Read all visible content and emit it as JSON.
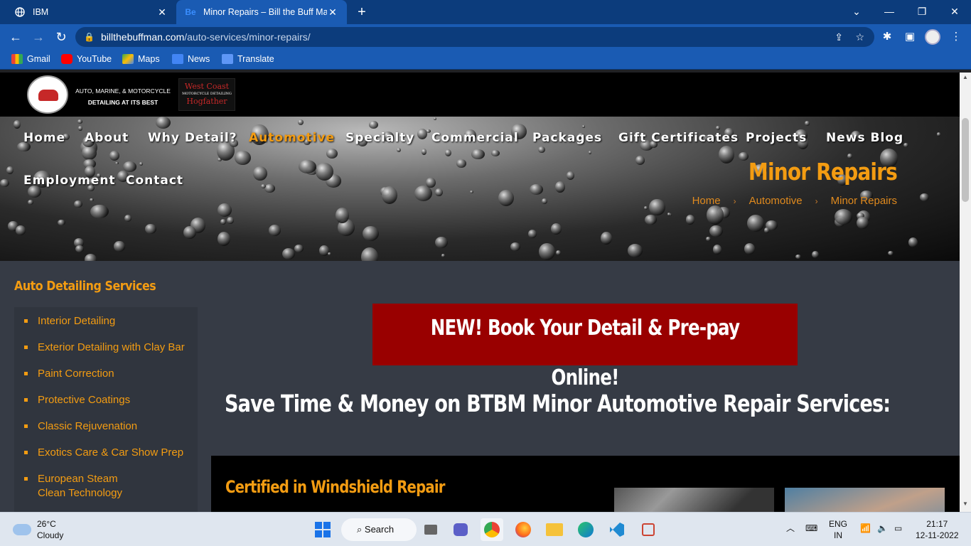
{
  "browser": {
    "tabs": [
      {
        "title": "IBM",
        "favicon": "globe-icon",
        "active": false
      },
      {
        "title": "Minor Repairs – Bill the Buff Man",
        "favicon": "Be",
        "active": true
      }
    ],
    "url_host": "billthebuffman.com",
    "url_path": "/auto-services/minor-repairs/",
    "bookmarks": [
      "Gmail",
      "YouTube",
      "Maps",
      "News",
      "Translate"
    ]
  },
  "site": {
    "tagline_line1": "AUTO, MARINE, & MOTORCYCLE",
    "tagline_line2": "DETAILING AT ITS BEST",
    "partner_logo_top": "West Coast",
    "partner_logo_mid": "MOTORCYCLE DETAILING",
    "partner_logo_bottom": "Hogfather",
    "nav": [
      {
        "label": "Home",
        "active": false
      },
      {
        "label": "About",
        "active": false
      },
      {
        "label": "Why Detail?",
        "active": false
      },
      {
        "label": "Automotive",
        "active": true
      },
      {
        "label": "Specialty",
        "active": false
      },
      {
        "label": "Commercial",
        "active": false
      },
      {
        "label": "Packages",
        "active": false
      },
      {
        "label": "Gift Certificates",
        "active": false
      },
      {
        "label": "Projects",
        "active": false
      },
      {
        "label": "News Blog",
        "active": false
      },
      {
        "label": "Employment",
        "active": false
      },
      {
        "label": "Contact",
        "active": false
      }
    ],
    "page_title": "Minor Repairs",
    "breadcrumb": [
      "Home",
      "Automotive",
      "Minor Repairs"
    ],
    "breadcrumb_sep": "›",
    "sidebar": {
      "heading": "Auto Detailing Services",
      "items": [
        "Interior Detailing",
        "Exterior Detailing with Clay Bar",
        "Paint Correction",
        "Protective Coatings",
        "Classic Rejuvenation",
        "Exotics Care & Car Show Prep",
        "European Steam Clean Technology"
      ]
    },
    "book_banner": "NEW! Book Your Detail & Pre-pay Online!",
    "headline": "Save Time & Money on BTBM Minor Automotive Repair Services:",
    "section_heading": "Certified in Windshield Repair"
  },
  "taskbar": {
    "weather_temp": "26°C",
    "weather_text": "Cloudy",
    "search_label": "Search",
    "lang_line1": "ENG",
    "lang_line2": "IN",
    "time": "21:17",
    "date": "12-11-2022"
  },
  "colors": {
    "accent": "#f39c12",
    "banner": "#990000",
    "chrome": "#1a5bb3"
  }
}
